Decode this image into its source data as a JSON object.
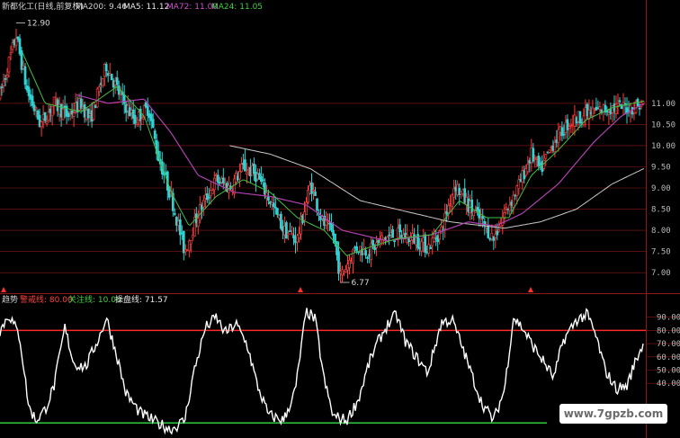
{
  "header": {
    "stock": "新都化工(日线,前复权)",
    "ma200": "MA200: 9.46",
    "ma5": "MA5: 11.12",
    "ma72": "MA72: 11.00",
    "ma24": "MA24: 11.05"
  },
  "indicator_header": {
    "name": "趋势",
    "warn": "警戒线: 80.00",
    "focus": "关注线: 10.00",
    "operate": "操盘线: 71.57"
  },
  "watermark": "www.7gpzb.com",
  "colors": {
    "background": "#000000",
    "candle_up": "#ff3b3b",
    "candle_down": "#2fd3d3",
    "ma5": "#e8e8e8",
    "ma24": "#40c040",
    "ma72": "#b040b0",
    "ma200": "#c8c8c8",
    "warn_line": "#ff2a2a",
    "focus_line": "#2ecc40",
    "oscillator": "#ffffff",
    "grid": "#8b1a1a"
  },
  "chart_data": [
    {
      "type": "candlestick",
      "price_axis": {
        "ticks": [
          "11.00",
          "10.50",
          "10.00",
          "9.50",
          "9.00",
          "8.50",
          "8.00",
          "7.50",
          "7.00"
        ],
        "range": [
          6.6,
          13.1
        ]
      },
      "annotations": [
        {
          "text": "12.90",
          "value": 12.9,
          "bar": 18
        },
        {
          "text": "6.77",
          "value": 6.77,
          "bar": 378
        }
      ],
      "keypoints": [
        [
          0,
          11.2
        ],
        [
          18,
          12.6
        ],
        [
          30,
          11.3
        ],
        [
          45,
          10.5
        ],
        [
          60,
          11.0
        ],
        [
          75,
          10.7
        ],
        [
          90,
          11.0
        ],
        [
          100,
          10.6
        ],
        [
          118,
          11.9
        ],
        [
          135,
          11.1
        ],
        [
          150,
          10.6
        ],
        [
          165,
          10.9
        ],
        [
          175,
          9.8
        ],
        [
          190,
          8.8
        ],
        [
          205,
          7.5
        ],
        [
          220,
          8.4
        ],
        [
          240,
          9.2
        ],
        [
          255,
          9.0
        ],
        [
          270,
          9.5
        ],
        [
          285,
          9.3
        ],
        [
          300,
          8.7
        ],
        [
          315,
          8.0
        ],
        [
          330,
          7.8
        ],
        [
          345,
          9.1
        ],
        [
          358,
          8.2
        ],
        [
          370,
          7.9
        ],
        [
          378,
          6.9
        ],
        [
          395,
          7.6
        ],
        [
          410,
          7.5
        ],
        [
          425,
          7.8
        ],
        [
          440,
          7.9
        ],
        [
          460,
          7.8
        ],
        [
          475,
          7.6
        ],
        [
          490,
          8.0
        ],
        [
          505,
          9.1
        ],
        [
          520,
          8.6
        ],
        [
          535,
          8.2
        ],
        [
          548,
          7.8
        ],
        [
          560,
          8.4
        ],
        [
          575,
          9.0
        ],
        [
          590,
          9.8
        ],
        [
          600,
          9.4
        ],
        [
          615,
          10.1
        ],
        [
          630,
          10.5
        ],
        [
          645,
          10.7
        ],
        [
          660,
          10.8
        ],
        [
          680,
          10.9
        ],
        [
          700,
          10.9
        ],
        [
          715,
          11.0
        ]
      ],
      "ma200_keypoints": [
        [
          255,
          10.0
        ],
        [
          300,
          9.8
        ],
        [
          345,
          9.45
        ],
        [
          400,
          8.7
        ],
        [
          500,
          8.2
        ],
        [
          560,
          8.05
        ],
        [
          600,
          8.2
        ],
        [
          640,
          8.5
        ],
        [
          680,
          9.1
        ],
        [
          715,
          9.46
        ]
      ],
      "ma72_keypoints": [
        [
          85,
          11.2
        ],
        [
          120,
          11.0
        ],
        [
          160,
          11.1
        ],
        [
          190,
          10.3
        ],
        [
          220,
          9.3
        ],
        [
          260,
          8.9
        ],
        [
          300,
          8.8
        ],
        [
          340,
          8.6
        ],
        [
          380,
          8.0
        ],
        [
          430,
          7.75
        ],
        [
          480,
          7.9
        ],
        [
          520,
          8.2
        ],
        [
          550,
          8.1
        ],
        [
          580,
          8.4
        ],
        [
          620,
          9.1
        ],
        [
          660,
          10.1
        ],
        [
          690,
          10.7
        ],
        [
          715,
          11.0
        ]
      ],
      "ma24_keypoints": [
        [
          25,
          12.2
        ],
        [
          50,
          11.0
        ],
        [
          90,
          10.8
        ],
        [
          130,
          11.4
        ],
        [
          160,
          10.7
        ],
        [
          190,
          8.9
        ],
        [
          210,
          8.1
        ],
        [
          240,
          8.8
        ],
        [
          270,
          9.2
        ],
        [
          300,
          8.9
        ],
        [
          330,
          8.3
        ],
        [
          360,
          8.0
        ],
        [
          385,
          7.4
        ],
        [
          410,
          7.6
        ],
        [
          440,
          7.8
        ],
        [
          480,
          7.9
        ],
        [
          510,
          8.7
        ],
        [
          540,
          8.3
        ],
        [
          565,
          8.3
        ],
        [
          590,
          9.3
        ],
        [
          620,
          9.9
        ],
        [
          650,
          10.6
        ],
        [
          680,
          10.9
        ],
        [
          715,
          11.05
        ]
      ]
    },
    {
      "type": "line",
      "y_axis": {
        "ticks": [
          "90.00",
          "80.00",
          "70.00",
          "60.00",
          "50.00",
          "40.00"
        ],
        "range": [
          0,
          100
        ]
      },
      "reference_lines": [
        {
          "name": "警戒线",
          "value": 80.0
        },
        {
          "name": "关注线",
          "value": 10.0
        }
      ],
      "series": [
        {
          "name": "操盘线",
          "last": 71.57,
          "keypoints": [
            [
              0,
              80
            ],
            [
              10,
              92
            ],
            [
              22,
              75
            ],
            [
              32,
              22
            ],
            [
              40,
              12
            ],
            [
              50,
              20
            ],
            [
              60,
              38
            ],
            [
              72,
              82
            ],
            [
              82,
              55
            ],
            [
              95,
              52
            ],
            [
              112,
              78
            ],
            [
              118,
              90
            ],
            [
              130,
              60
            ],
            [
              140,
              32
            ],
            [
              155,
              18
            ],
            [
              175,
              10
            ],
            [
              190,
              5
            ],
            [
              205,
              12
            ],
            [
              215,
              48
            ],
            [
              228,
              82
            ],
            [
              240,
              90
            ],
            [
              250,
              78
            ],
            [
              262,
              85
            ],
            [
              275,
              68
            ],
            [
              285,
              40
            ],
            [
              298,
              16
            ],
            [
              315,
              12
            ],
            [
              328,
              35
            ],
            [
              340,
              95
            ],
            [
              350,
              88
            ],
            [
              360,
              42
            ],
            [
              370,
              15
            ],
            [
              385,
              12
            ],
            [
              398,
              28
            ],
            [
              410,
              56
            ],
            [
              420,
              72
            ],
            [
              430,
              84
            ],
            [
              440,
              92
            ],
            [
              450,
              72
            ],
            [
              462,
              60
            ],
            [
              475,
              48
            ],
            [
              490,
              86
            ],
            [
              502,
              88
            ],
            [
              512,
              70
            ],
            [
              522,
              50
            ],
            [
              535,
              25
            ],
            [
              548,
              12
            ],
            [
              560,
              35
            ],
            [
              570,
              90
            ],
            [
              580,
              82
            ],
            [
              592,
              68
            ],
            [
              602,
              58
            ],
            [
              615,
              44
            ],
            [
              625,
              72
            ],
            [
              640,
              88
            ],
            [
              652,
              92
            ],
            [
              662,
              75
            ],
            [
              672,
              50
            ],
            [
              684,
              36
            ],
            [
              696,
              38
            ],
            [
              705,
              56
            ],
            [
              715,
              71.57
            ]
          ]
        }
      ]
    }
  ]
}
